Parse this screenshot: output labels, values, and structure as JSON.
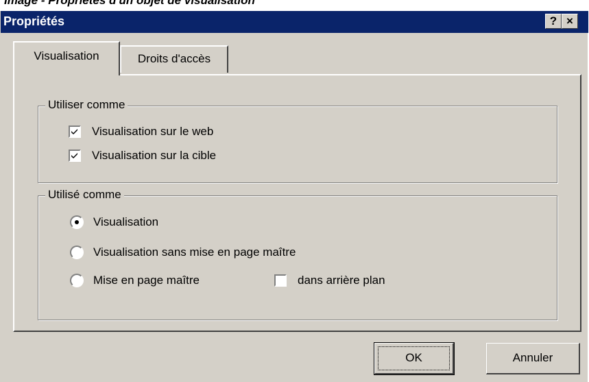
{
  "caption": "Image - Propriétés d'un objet de visualisation",
  "window": {
    "title": "Propriétés",
    "help_label": "?",
    "close_label": "×"
  },
  "tabs": [
    {
      "label": "Visualisation",
      "active": true
    },
    {
      "label": "Droits d'accès",
      "active": false
    }
  ],
  "group_use_as": {
    "legend": "Utiliser comme",
    "options": [
      {
        "label": "Visualisation sur le web",
        "checked": true
      },
      {
        "label": "Visualisation sur la cible",
        "checked": true
      }
    ]
  },
  "group_used_as": {
    "legend": "Utilisé comme",
    "radios": [
      {
        "label": "Visualisation",
        "selected": true
      },
      {
        "label": "Visualisation sans mise en page maître",
        "selected": false
      },
      {
        "label": "Mise en page maître",
        "selected": false
      }
    ],
    "background_checkbox": {
      "label": "dans arrière plan",
      "checked": false
    }
  },
  "buttons": {
    "ok": "OK",
    "cancel": "Annuler"
  },
  "colors": {
    "titlebar": "#0a246a",
    "face": "#d4d0c8"
  }
}
